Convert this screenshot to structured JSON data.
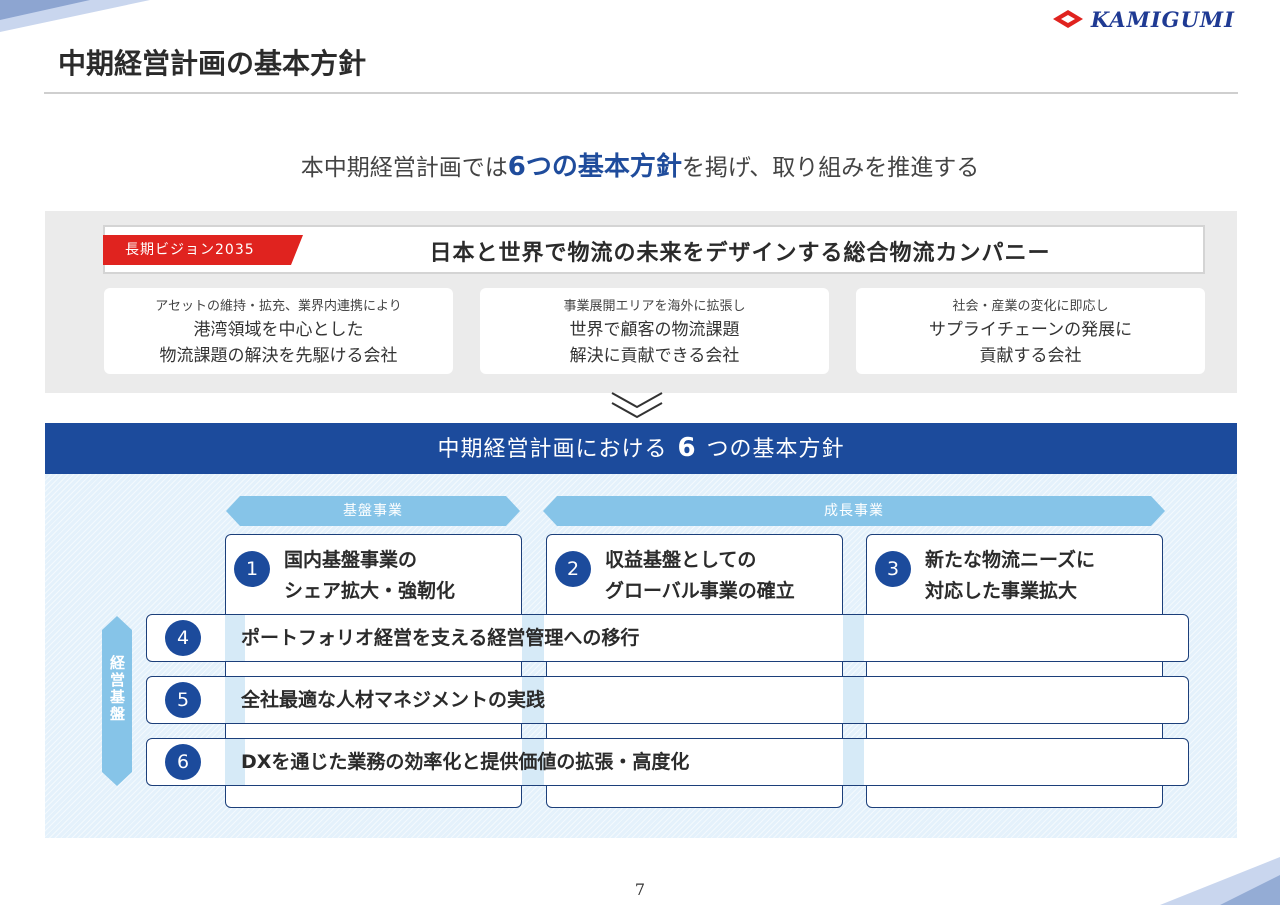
{
  "brand": {
    "name": "KAMIGUMI"
  },
  "title": "中期経営計画の基本方針",
  "lead": {
    "before": "本中期経営計画では",
    "emphasis": "6つの基本方針",
    "after": "を掲げ、取り組みを推進する"
  },
  "vision": {
    "tag": "長期ビジョン2035",
    "statement": "日本と世界で物流の未来をデザインする総合物流カンパニー",
    "cards": [
      {
        "small": "アセットの維持・拡充、業界内連携により",
        "line1": "港湾領域を中心とした",
        "line2": "物流課題の解決を先駆ける会社"
      },
      {
        "small": "事業展開エリアを海外に拡張し",
        "line1": "世界で顧客の物流課題",
        "line2": "解決に貢献できる会社"
      },
      {
        "small": "社会・産業の変化に即応し",
        "line1": "サプライチェーンの発展に",
        "line2": "貢献する会社"
      }
    ]
  },
  "band": {
    "before": "中期経営計画における",
    "number": "6",
    "after": "つの基本方針"
  },
  "headers": {
    "foundation": "基盤事業",
    "growth": "成長事業"
  },
  "side_label": "経営基盤",
  "policies": [
    {
      "num": "1",
      "line1": "国内基盤事業の",
      "line2": "シェア拡大・強靭化"
    },
    {
      "num": "2",
      "line1": "収益基盤としての",
      "line2": "グローバル事業の確立"
    },
    {
      "num": "3",
      "line1": "新たな物流ニーズに",
      "line2": "対応した事業拡大"
    },
    {
      "num": "4",
      "text": "ポートフォリオ経営を支える経営管理への移行"
    },
    {
      "num": "5",
      "text": "全社最適な人材マネジメントの実践"
    },
    {
      "num": "6",
      "text": "DXを通じた業務の効率化と提供価値の拡張・高度化"
    }
  ],
  "page_number": "7",
  "colors": {
    "navy": "#1c4b9c",
    "light_blue": "#86c4e8",
    "red": "#e0231f",
    "panel_gray": "#ebebeb"
  }
}
